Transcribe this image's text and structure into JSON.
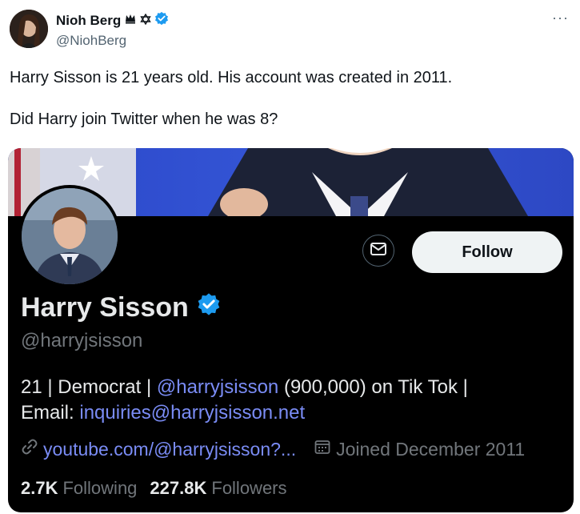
{
  "tweet": {
    "author_name": "Nioh Berg",
    "author_handle": "@NiohBerg",
    "more_label": "···",
    "text_line1": "Harry Sisson is 21 years old. His account was created in 2011.",
    "text_line2": "Did Harry join Twitter when he was 8?"
  },
  "profile_card": {
    "name": "Harry Sisson",
    "handle": "@harryjsisson",
    "follow_label": "Follow",
    "bio": {
      "part1": "21 | Democrat | ",
      "link_handle": "@harryjsisson",
      "part2": " (900,000) on Tik Tok |",
      "email_label": "Email: ",
      "email": "inquiries@harryjsisson.net"
    },
    "website": "youtube.com/@harryjsisson?...",
    "joined": "Joined December 2011",
    "following_count": "2.7K",
    "following_label": "Following",
    "followers_count": "227.8K",
    "followers_label": "Followers"
  },
  "icons": {
    "author_badges": [
      "crown-icon",
      "star-of-david-icon",
      "verified-badge-icon"
    ],
    "profile": [
      "message-icon",
      "verified-badge-icon",
      "link-icon",
      "calendar-icon"
    ]
  },
  "colors": {
    "verified_blue": "#1d9bf0",
    "link": "#7a8cf5",
    "card_bg": "#000000",
    "follow_bg": "#eff3f4"
  }
}
